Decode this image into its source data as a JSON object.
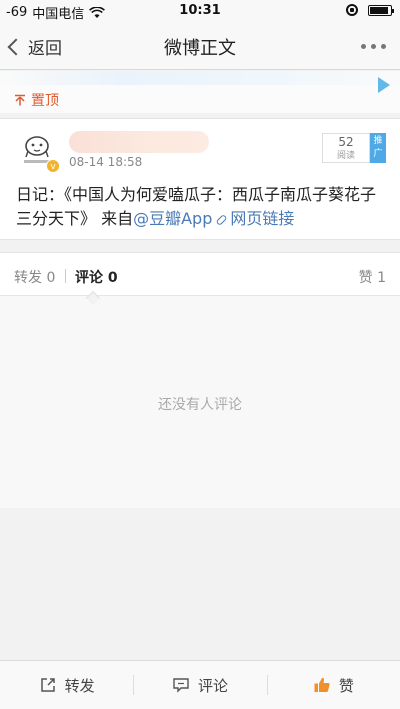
{
  "status_bar": {
    "signal": "-69",
    "carrier": "中国电信",
    "time": "10:31"
  },
  "nav": {
    "back_label": "返回",
    "title": "微博正文"
  },
  "pinned": {
    "label": "置顶"
  },
  "post": {
    "time": "08-14 18:58",
    "read_count": "52",
    "read_label": "阅读",
    "promo_label": "推广",
    "text": "日记：《中国人为何爱嗑瓜子：西瓜子南瓜子葵花子三分天下》 来自",
    "source_link": "@豆瓣App",
    "web_link": "网页链接"
  },
  "tabs": {
    "repost_label": "转发",
    "repost_count": "0",
    "comment_label": "评论",
    "comment_count": "0",
    "like_label": "赞",
    "like_count": "1"
  },
  "empty_message": "还没有人评论",
  "toolbar": {
    "repost": "转发",
    "comment": "评论",
    "like": "赞"
  },
  "colors": {
    "accent_orange": "#e05a2f",
    "link_blue": "#4a7ab5",
    "promo_blue": "#4ea9e6",
    "verified_gold": "#f3b32c"
  }
}
